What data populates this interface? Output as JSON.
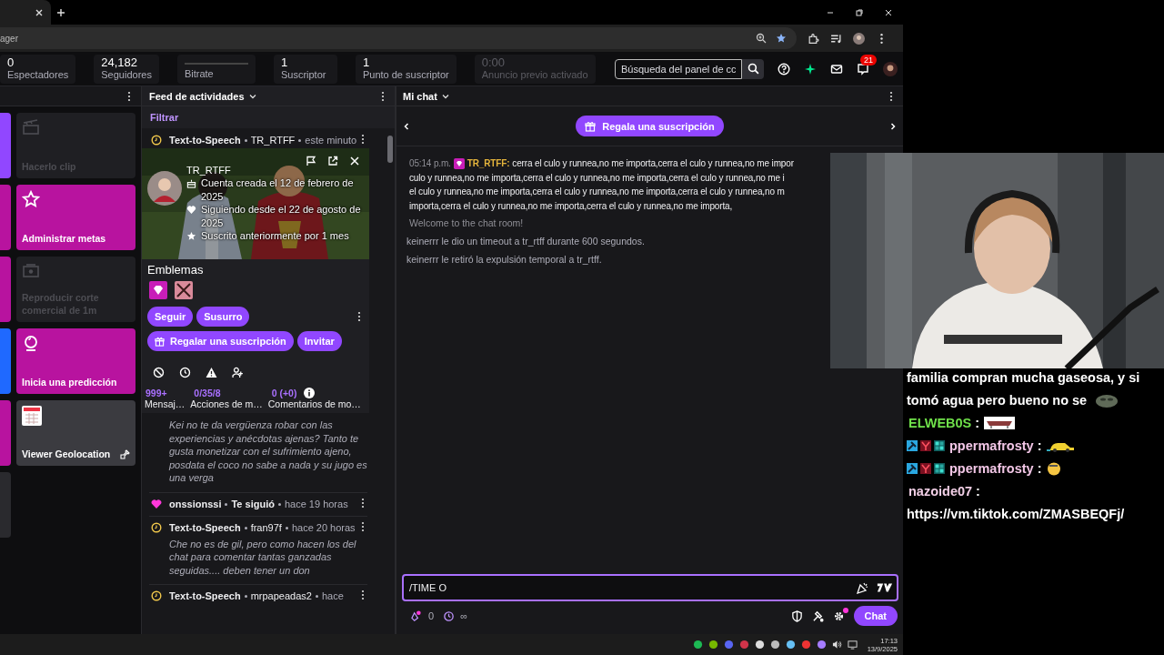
{
  "browser": {
    "address": "ager"
  },
  "stats": [
    {
      "kind": "number",
      "value": "0",
      "label": "Espectadores",
      "disabled": false
    },
    {
      "kind": "number",
      "value": "24,182",
      "label": "Seguidores",
      "disabled": false
    },
    {
      "kind": "graph",
      "label": "Bitrate",
      "disabled": false
    },
    {
      "kind": "number",
      "value": "1",
      "label": "Suscriptor",
      "disabled": false
    },
    {
      "kind": "number",
      "value": "1",
      "label": "Punto de suscriptor",
      "disabled": false
    },
    {
      "kind": "number",
      "value": "0:00",
      "label": "Anuncio previo activado",
      "disabled": true
    }
  ],
  "search": {
    "placeholder": "Búsqueda del panel de cc"
  },
  "notifications": {
    "count": "21"
  },
  "quick_actions": {
    "hidden_tiles": [
      {
        "color": "#9147ff"
      },
      {
        "color": "#b8139f"
      },
      {
        "color": "#b8139f"
      },
      {
        "color": "#1f69ff"
      },
      {
        "color": "#b8139f"
      },
      {
        "color": "#2a2a2e"
      }
    ],
    "tiles": [
      {
        "kind": "clip",
        "label": "Hacerlo clip",
        "disabled": true,
        "color": "#1f1f23"
      },
      {
        "kind": "goals",
        "label": "Administrar metas",
        "disabled": false,
        "color": "#b8139f"
      },
      {
        "kind": "ad",
        "label": "Reproducir corte comercial de 1m",
        "disabled": true,
        "color": "#1f1f23"
      },
      {
        "kind": "prediction",
        "label": "Inicia una predicción",
        "disabled": false,
        "color": "#b8139f"
      },
      {
        "kind": "extension",
        "label": "Viewer Geolocation",
        "disabled": false,
        "color": "#3b3b40"
      }
    ]
  },
  "feed": {
    "title": "Feed de actividades",
    "filter": "Filtrar",
    "first_item": {
      "kind": "tts",
      "title": "Text-to-Speech",
      "user": "TR_RTFF",
      "time": "este minuto"
    },
    "user_card": {
      "name": "TR_RTFF",
      "details": [
        {
          "kind": "created",
          "text": "Cuenta creada el 12 de febrero de 2025"
        },
        {
          "kind": "following",
          "text": "Siguiendo desde el 22 de agosto de 2025"
        },
        {
          "kind": "subscribed",
          "text": "Suscrito anteriormente por 1 mes"
        }
      ],
      "badges_title": "Emblemas",
      "badges": [
        {
          "kind": "diamond"
        },
        {
          "kind": "crossed"
        }
      ],
      "actions": [
        {
          "label": "Seguir"
        },
        {
          "label": "Susurro"
        }
      ],
      "wide_actions": [
        {
          "kind": "gift",
          "label": "Regalar una suscripción"
        },
        {
          "kind": "plain",
          "label": "Invitar"
        }
      ],
      "stats": [
        {
          "value": "999+",
          "label": "Mensaj…",
          "info": false
        },
        {
          "value": "0/35/8",
          "label": "Acciones de m…",
          "info": false
        },
        {
          "value": "0 (+0)",
          "label": "Comentarios de mo…",
          "info": true
        }
      ]
    },
    "items": [
      {
        "message": "Kei no te da vergüenza robar con las experiencias y anécdotas ajenas? Tanto te gusta monetizar con el sufrimiento ajeno, posdata el coco no sabe a nada y su jugo es una verga"
      },
      {
        "kind": "follow",
        "user": "onssionssi",
        "title": "Te siguió",
        "time": "hace 19 horas"
      },
      {
        "kind": "tts",
        "title": "Text-to-Speech",
        "user": "fran97f",
        "time": "hace 20 horas",
        "message": "Che no es de gil, pero como hacen los del chat para comentar tantas ganzadas seguidas.... deben tener un don"
      },
      {
        "kind": "tts",
        "title": "Text-to-Speech",
        "user": "mrpapeadas2",
        "time": "hace"
      }
    ]
  },
  "chat": {
    "title": "Mi chat",
    "promo": "Regala una suscripción",
    "messages": [
      {
        "kind": "user",
        "time": "05:14 p.m.",
        "user": "TR_RTFF:",
        "color": "#e4b43c",
        "lines": [
          "cerra el culo y runnea,no me importa,cerra el culo y runnea,no me impor",
          "culo y runnea,no me importa,cerra el culo y runnea,no me importa,cerra el culo y runnea,no me i",
          "el culo y runnea,no me importa,cerra el culo y runnea,no me importa,cerra el culo y runnea,no m",
          "importa,cerra el culo y runnea,no me importa,cerra el culo y runnea,no me importa,"
        ]
      },
      {
        "kind": "welcome",
        "text": "Welcome to the chat room!"
      },
      {
        "kind": "notice",
        "text": "keinerrr le dio un timeout a tr_rtff durante 600 segundos."
      },
      {
        "kind": "notice",
        "text": "keinerrr le retiró la expulsión temporal a tr_rtff."
      }
    ],
    "input": {
      "value": "/TIME O"
    },
    "bits": "0",
    "timer": "∞",
    "send": "Chat"
  },
  "overlay": {
    "messages": [
      {
        "lines": [
          "familia compran mucha gaseosa, y si",
          "tomó agua pero bueno no se"
        ],
        "emote": {
          "kind": "blob"
        }
      },
      {
        "user": "ELWEB0S",
        "color": "#6fe04a",
        "suffix": ":",
        "emote": {
          "kind": "couch"
        },
        "badges": false
      },
      {
        "user": "ppermafrosty",
        "color": "#f2c6e6",
        "suffix": ":",
        "emote": {
          "kind": "car"
        },
        "badges": true
      },
      {
        "user": "ppermafrosty",
        "color": "#f2c6e6",
        "suffix": ":",
        "emote": {
          "kind": "face"
        },
        "badges": true
      },
      {
        "user": "nazoide07",
        "color": "#f2cfe6",
        "suffix": ":",
        "lines": [
          "https://vm.tiktok.com/ZMASBEQFj/"
        ],
        "badges": false
      }
    ]
  },
  "taskbar": {
    "time": "17:13",
    "date": "13/9/2025"
  }
}
